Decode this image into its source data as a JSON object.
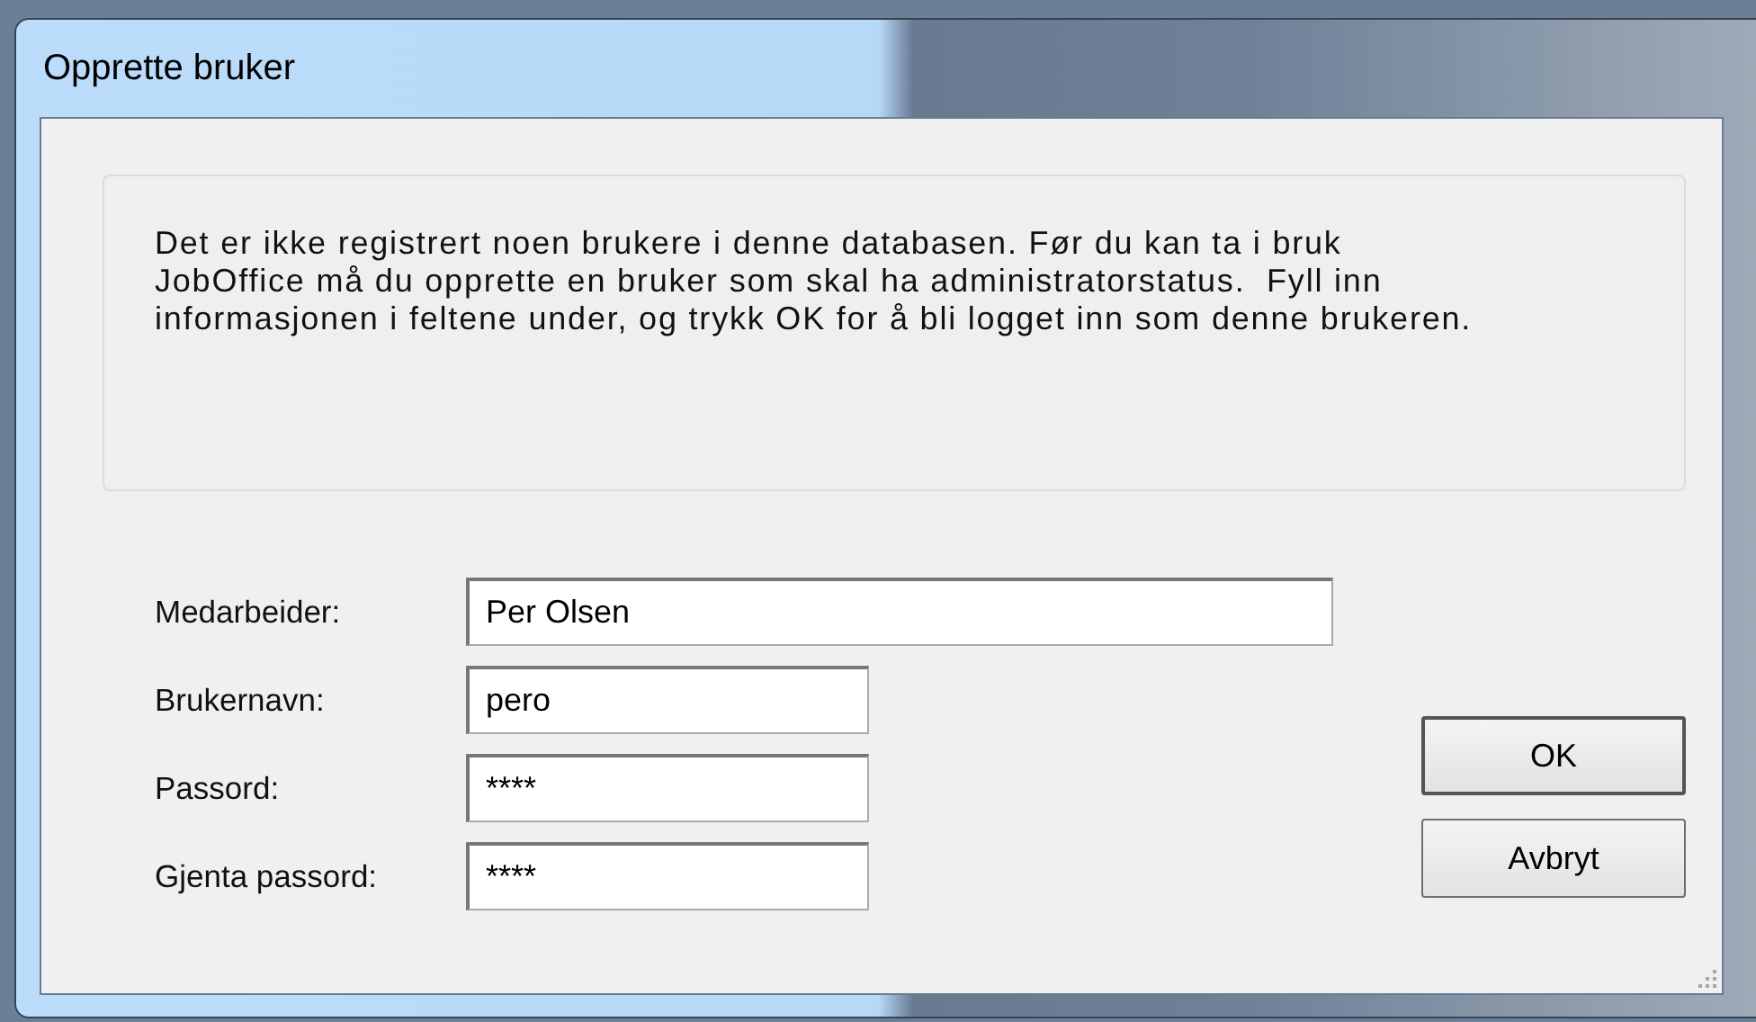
{
  "window": {
    "title": "Opprette bruker"
  },
  "message": "Det er ikke registrert noen brukere i denne databasen. Før du kan ta i bruk JobOffice må du opprette en bruker som skal ha administratorstatus.  Fyll inn informasjonen i feltene under, og trykk OK for å bli logget inn som denne brukeren.",
  "fields": [
    {
      "label": "Medarbeider:",
      "value": "Per Olsen",
      "kind": "wide"
    },
    {
      "label": "Brukernavn:",
      "value": "pero",
      "kind": "short"
    },
    {
      "label": "Passord:",
      "value": "****",
      "kind": "short"
    },
    {
      "label": "Gjenta passord:",
      "value": "****",
      "kind": "short"
    }
  ],
  "buttons": [
    "OK",
    "Avbryt"
  ]
}
